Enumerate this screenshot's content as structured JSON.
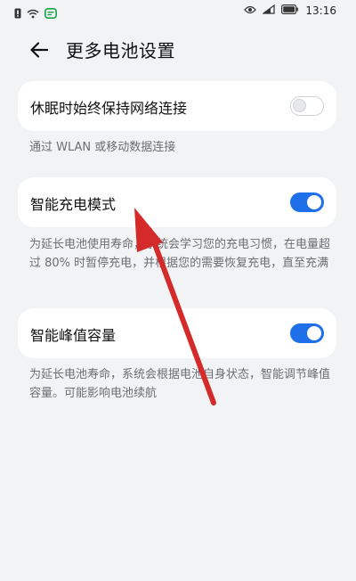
{
  "status_bar": {
    "time": "13:16",
    "left_icons": [
      "alert-icon",
      "wifi-icon",
      "message-icon"
    ],
    "right_icons": [
      "eye-icon",
      "signal-icon",
      "battery-icon"
    ]
  },
  "header": {
    "title": "更多电池设置"
  },
  "settings": [
    {
      "label": "休眠时始终保持网络连接",
      "enabled": false,
      "description": "通过 WLAN 或移动数据连接"
    },
    {
      "label": "智能充电模式",
      "enabled": true,
      "description": "为延长电池使用寿命，系统会学习您的充电习惯，在电量超过 80% 时暂停充电，并根据您的需要恢复充电，直至充满"
    },
    {
      "label": "智能峰值容量",
      "enabled": true,
      "description": "为延长电池寿命，系统会根据电池自身状态，智能调节峰值容量。可能影响电池续航"
    }
  ],
  "colors": {
    "accent": "#1f6fe8",
    "background": "#f1f3f5",
    "card": "#ffffff",
    "annotation_arrow": "#d42a2a"
  }
}
